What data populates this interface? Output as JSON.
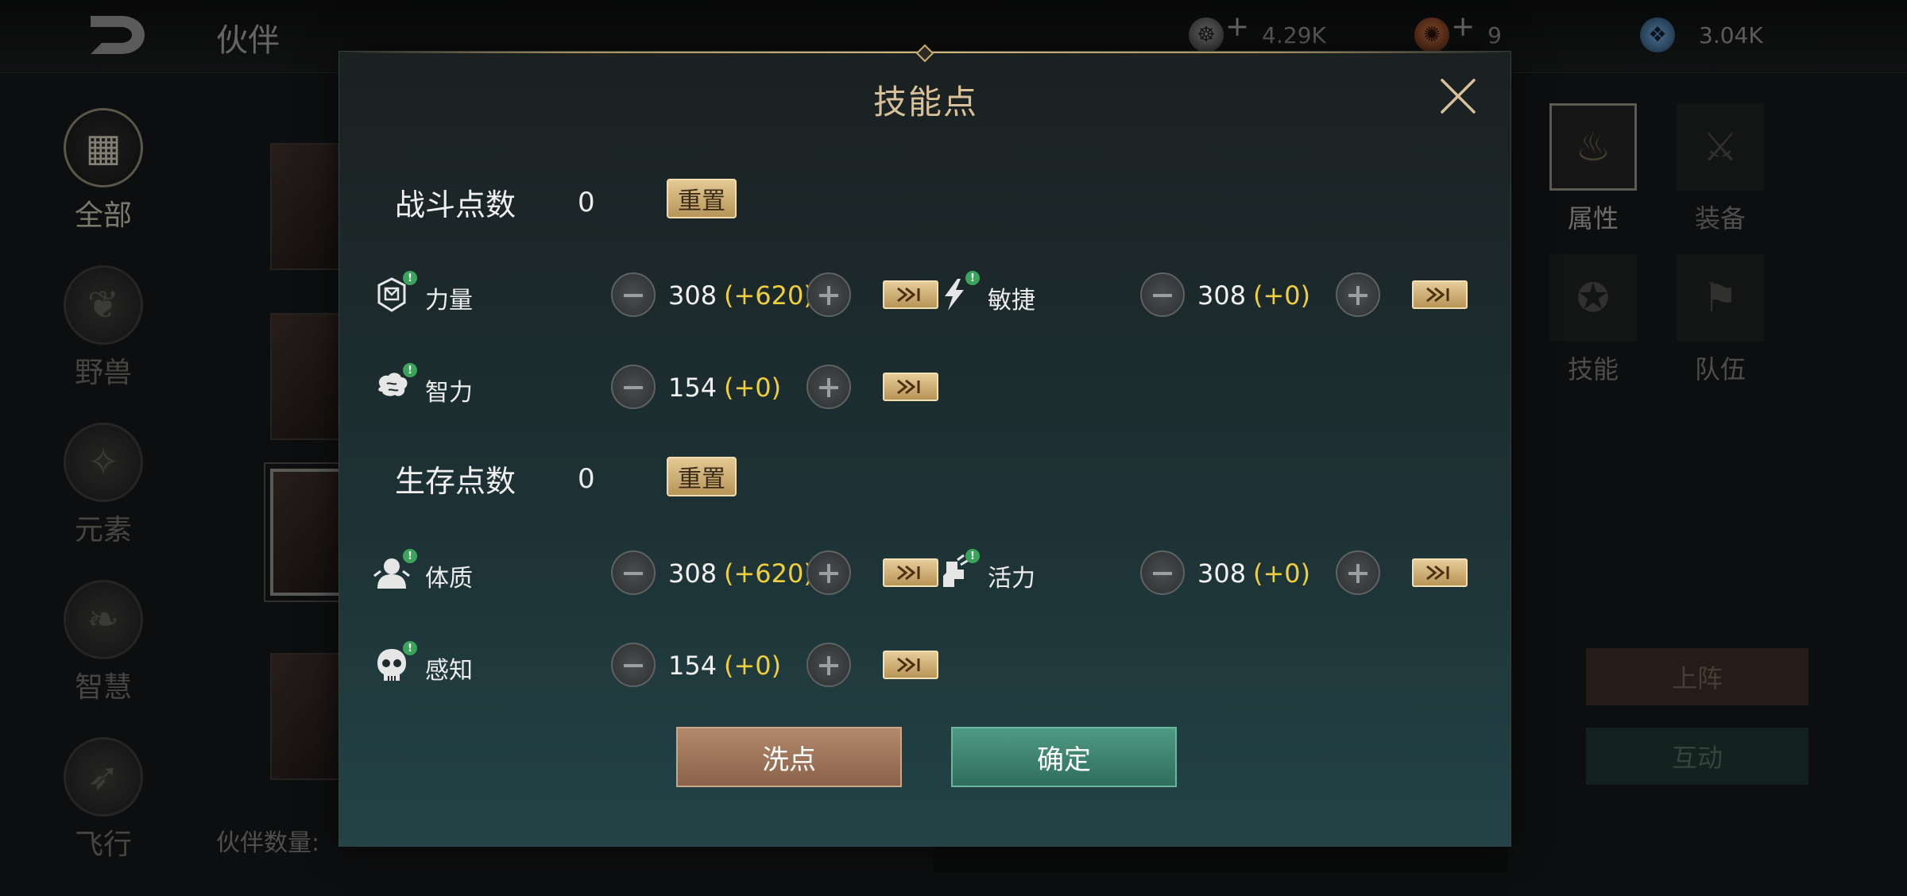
{
  "header": {
    "title": "伙伴",
    "currencies": [
      {
        "icon": "soul-coin-icon",
        "value": "4.29K",
        "has_plus": true
      },
      {
        "icon": "fire-coin-icon",
        "value": "9",
        "has_plus": true
      },
      {
        "icon": "blue-gem-icon",
        "value": "3.04K",
        "has_plus": false
      }
    ]
  },
  "left_nav": [
    {
      "label": "全部",
      "icon": "grid-icon",
      "active": true
    },
    {
      "label": "野兽",
      "icon": "beast-icon",
      "active": false
    },
    {
      "label": "元素",
      "icon": "element-icon",
      "active": false
    },
    {
      "label": "智慧",
      "icon": "wisdom-icon",
      "active": false
    },
    {
      "label": "飞行",
      "icon": "flight-icon",
      "active": false
    }
  ],
  "partner_count_label": "伙伴数量:",
  "right_tabs": [
    {
      "label": "属性",
      "icon": "flame-icon",
      "active": true
    },
    {
      "label": "装备",
      "icon": "crossed-swords-icon",
      "active": false
    },
    {
      "label": "技能",
      "icon": "skill-icon",
      "active": false
    },
    {
      "label": "队伍",
      "icon": "flag-icon",
      "active": false
    }
  ],
  "side_buttons": {
    "deploy": "上阵",
    "interact": "互动"
  },
  "modal": {
    "title": "技能点",
    "combat": {
      "title": "战斗点数",
      "value": "0",
      "reset_label": "重置",
      "stats": [
        {
          "name": "力量",
          "icon": "strength-icon",
          "value": "308",
          "bonus": "(+620)"
        },
        {
          "name": "敏捷",
          "icon": "agility-icon",
          "value": "308",
          "bonus": "(+0)"
        },
        {
          "name": "智力",
          "icon": "intellect-icon",
          "value": "154",
          "bonus": "(+0)"
        }
      ]
    },
    "survival": {
      "title": "生存点数",
      "value": "0",
      "reset_label": "重置",
      "stats": [
        {
          "name": "体质",
          "icon": "constitution-icon",
          "value": "308",
          "bonus": "(+620)"
        },
        {
          "name": "活力",
          "icon": "vitality-icon",
          "value": "308",
          "bonus": "(+0)"
        },
        {
          "name": "感知",
          "icon": "perception-icon",
          "value": "154",
          "bonus": "(+0)"
        }
      ]
    },
    "wash_label": "洗点",
    "confirm_label": "确定"
  },
  "colors": {
    "bonus": "#f0cf3a",
    "title": "#d8c199",
    "confirm": "#3f8a74",
    "wash": "#9e745a"
  }
}
